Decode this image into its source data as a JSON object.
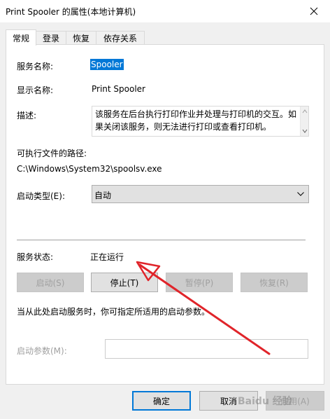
{
  "window": {
    "title": "Print Spooler 的属性(本地计算机)"
  },
  "tabs": [
    {
      "label": "常规",
      "active": true
    },
    {
      "label": "登录",
      "active": false
    },
    {
      "label": "恢复",
      "active": false
    },
    {
      "label": "依存关系",
      "active": false
    }
  ],
  "general": {
    "service_name_label": "服务名称:",
    "service_name_value": "Spooler",
    "display_name_label": "显示名称:",
    "display_name_value": "Print Spooler",
    "description_label": "描述:",
    "description_value": "该服务在后台执行打印作业并处理与打印机的交互。如果关闭该服务，则无法进行打印或查看打印机。",
    "exe_path_label": "可执行文件的路径:",
    "exe_path_value": "C:\\Windows\\System32\\spoolsv.exe",
    "startup_type_label": "启动类型(E):",
    "startup_type_value": "自动",
    "status_label": "服务状态:",
    "status_value": "正在运行",
    "buttons": {
      "start": "启动(S)",
      "stop": "停止(T)",
      "pause": "暂停(P)",
      "resume": "恢复(R)"
    },
    "hint_text": "当从此处启动服务时，你可指定所适用的启动参数。",
    "start_params_label": "启动参数(M):",
    "start_params_value": ""
  },
  "footer": {
    "ok": "确定",
    "cancel": "取消",
    "apply": "应用(A)"
  },
  "watermark": "Baidu 经验",
  "colors": {
    "selection": "#0078d7",
    "annotation_arrow": "#e0242a",
    "dialog_bg": "#f0f0f0"
  }
}
